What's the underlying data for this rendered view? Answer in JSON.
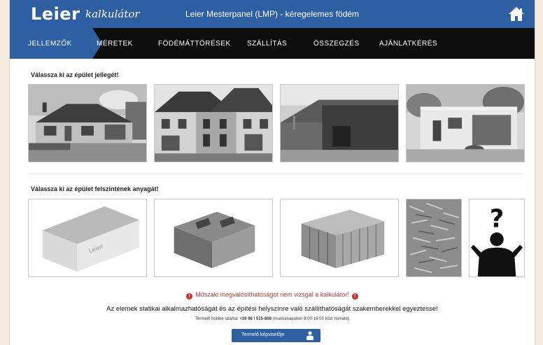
{
  "header": {
    "logo_text": "Leier",
    "logo_sub": "kalkulátor",
    "title": "Leier Mesterpanel (LMP) - kéregelemes födém",
    "home_icon": "home-icon"
  },
  "nav": {
    "items": [
      {
        "label": "JELLEMZŐK",
        "active": true
      },
      {
        "label": "MÉRETEK",
        "active": false
      },
      {
        "label": "FÖDÉMÁTTÖRÉSEK",
        "active": false
      },
      {
        "label": "SZÁLLÍTÁS",
        "active": false
      },
      {
        "label": "ÖSSZEGZÉS",
        "active": false
      },
      {
        "label": "AJÁNLATKÉRÉS",
        "active": false
      }
    ]
  },
  "building": {
    "label": "Válassza ki az épület jellegét!",
    "options": [
      "single-storey-house",
      "row-house",
      "industrial-hall",
      "garage-building"
    ]
  },
  "material": {
    "label": "Válassza ki az épület felszintének anyagát!",
    "options": [
      "panel-element",
      "concrete-block",
      "ceramic-brick",
      "wood-fiber",
      "unknown"
    ]
  },
  "footer": {
    "warning": "Műszaki megvalósíthatóságot nem vizsgál a kalkulátor!",
    "notice": "Az elemek statikai alkalmazhatóságát és az építési helyszínre való szállíthatóságát szakemberekkel egyeztesse!",
    "phone_prefix": "Termelő hotline száma:",
    "phone_number": "+36 96 / 515-868",
    "phone_suffix": "(munkanapokon 8:00-16:00 közt hívható)",
    "contact_label": "Termelő képviselője"
  },
  "colors": {
    "brand_blue": "#2f5fa3",
    "nav_black": "#0d0d0d",
    "warning_red": "#b33a3a"
  }
}
